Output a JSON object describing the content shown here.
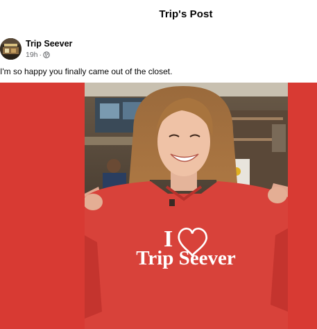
{
  "header": {
    "title": "Trip's Post"
  },
  "post": {
    "author": "Trip Seever",
    "time": "19h",
    "separator": "·",
    "audience_icon": "globe-icon",
    "text": "I'm so happy you finally came out of the closet.",
    "photo": {
      "shirt_line1": "I",
      "shirt_line2": "Trip Seever"
    }
  },
  "colors": {
    "photo_background": "#d83a33",
    "shirt": "#d8423a",
    "meta_text": "#65676b"
  }
}
